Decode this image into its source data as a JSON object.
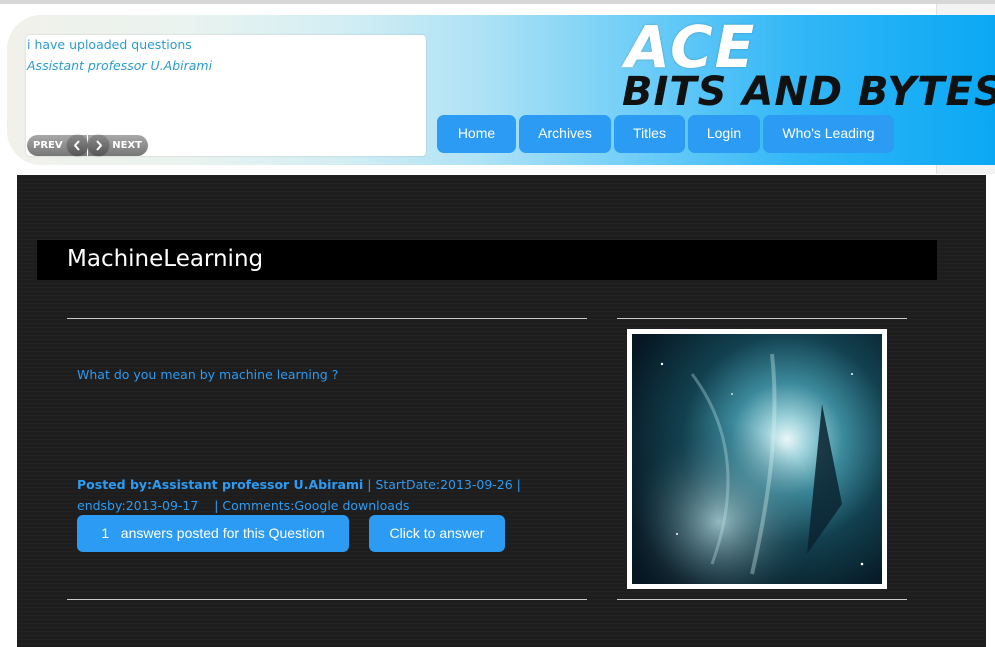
{
  "ticker": {
    "title": "i have uploaded questions",
    "author": "Assistant professor U.Abirami",
    "prev_label": "PREV",
    "next_label": "NEXT"
  },
  "logo": {
    "line1": "ACE",
    "line2": "BITS AND BYTES"
  },
  "nav": {
    "items": [
      {
        "label": "Home"
      },
      {
        "label": "Archives"
      },
      {
        "label": "Titles"
      },
      {
        "label": "Login"
      },
      {
        "label": "Who's Leading"
      }
    ]
  },
  "post": {
    "title": "MachineLearning",
    "question": "What do you mean by machine learning ?",
    "posted_by": "Posted by:Assistant professor U.Abirami",
    "start_date": " | StartDate:2013-09-26 | ",
    "ends_by": "endsby:2013-09-17",
    "comments": "| Comments:Google downloads",
    "answers_count": "1",
    "answers_label": "answers posted for this Question",
    "answer_button": "Click to answer"
  },
  "colors": {
    "accent": "#2c9bf3",
    "panel": "#1d1d1d",
    "banner_end": "#0aa8f4"
  },
  "icons": [
    "chevron-left-icon",
    "chevron-right-icon"
  ]
}
